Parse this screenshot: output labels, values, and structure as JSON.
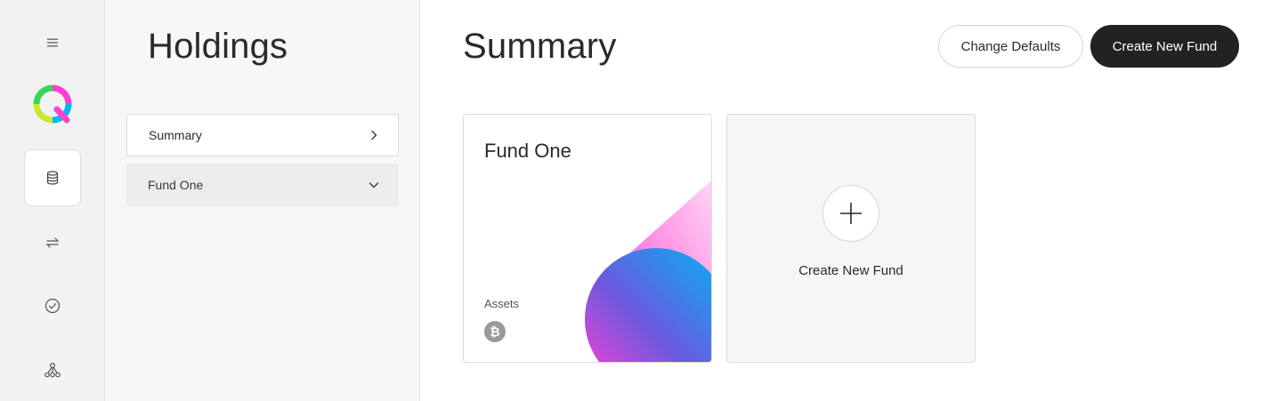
{
  "rail": {
    "items": [
      {
        "icon": "menu-icon"
      },
      {
        "icon": "logo-icon"
      },
      {
        "icon": "database-icon",
        "active": true
      },
      {
        "icon": "transfer-icon"
      },
      {
        "icon": "check-circle-icon"
      },
      {
        "icon": "network-icon"
      }
    ]
  },
  "panel": {
    "title": "Holdings",
    "items": [
      {
        "label": "Summary",
        "icon": "chevron-right-icon"
      },
      {
        "label": "Fund One",
        "icon": "chevron-down-icon"
      }
    ]
  },
  "main": {
    "title": "Summary",
    "change_defaults_label": "Change Defaults",
    "create_fund_label": "Create New Fund",
    "fund_card": {
      "name": "Fund One",
      "assets_label": "Assets",
      "asset_icons": [
        "bitcoin-icon"
      ]
    },
    "new_card": {
      "label": "Create New Fund",
      "icon": "plus-icon"
    }
  },
  "colors": {
    "dark_button": "#222222",
    "rail_bg": "#f2f2f2",
    "panel_bg": "#f7f7f7",
    "accent_pink": "#ff3fd0",
    "accent_blue": "#00a9f4"
  }
}
